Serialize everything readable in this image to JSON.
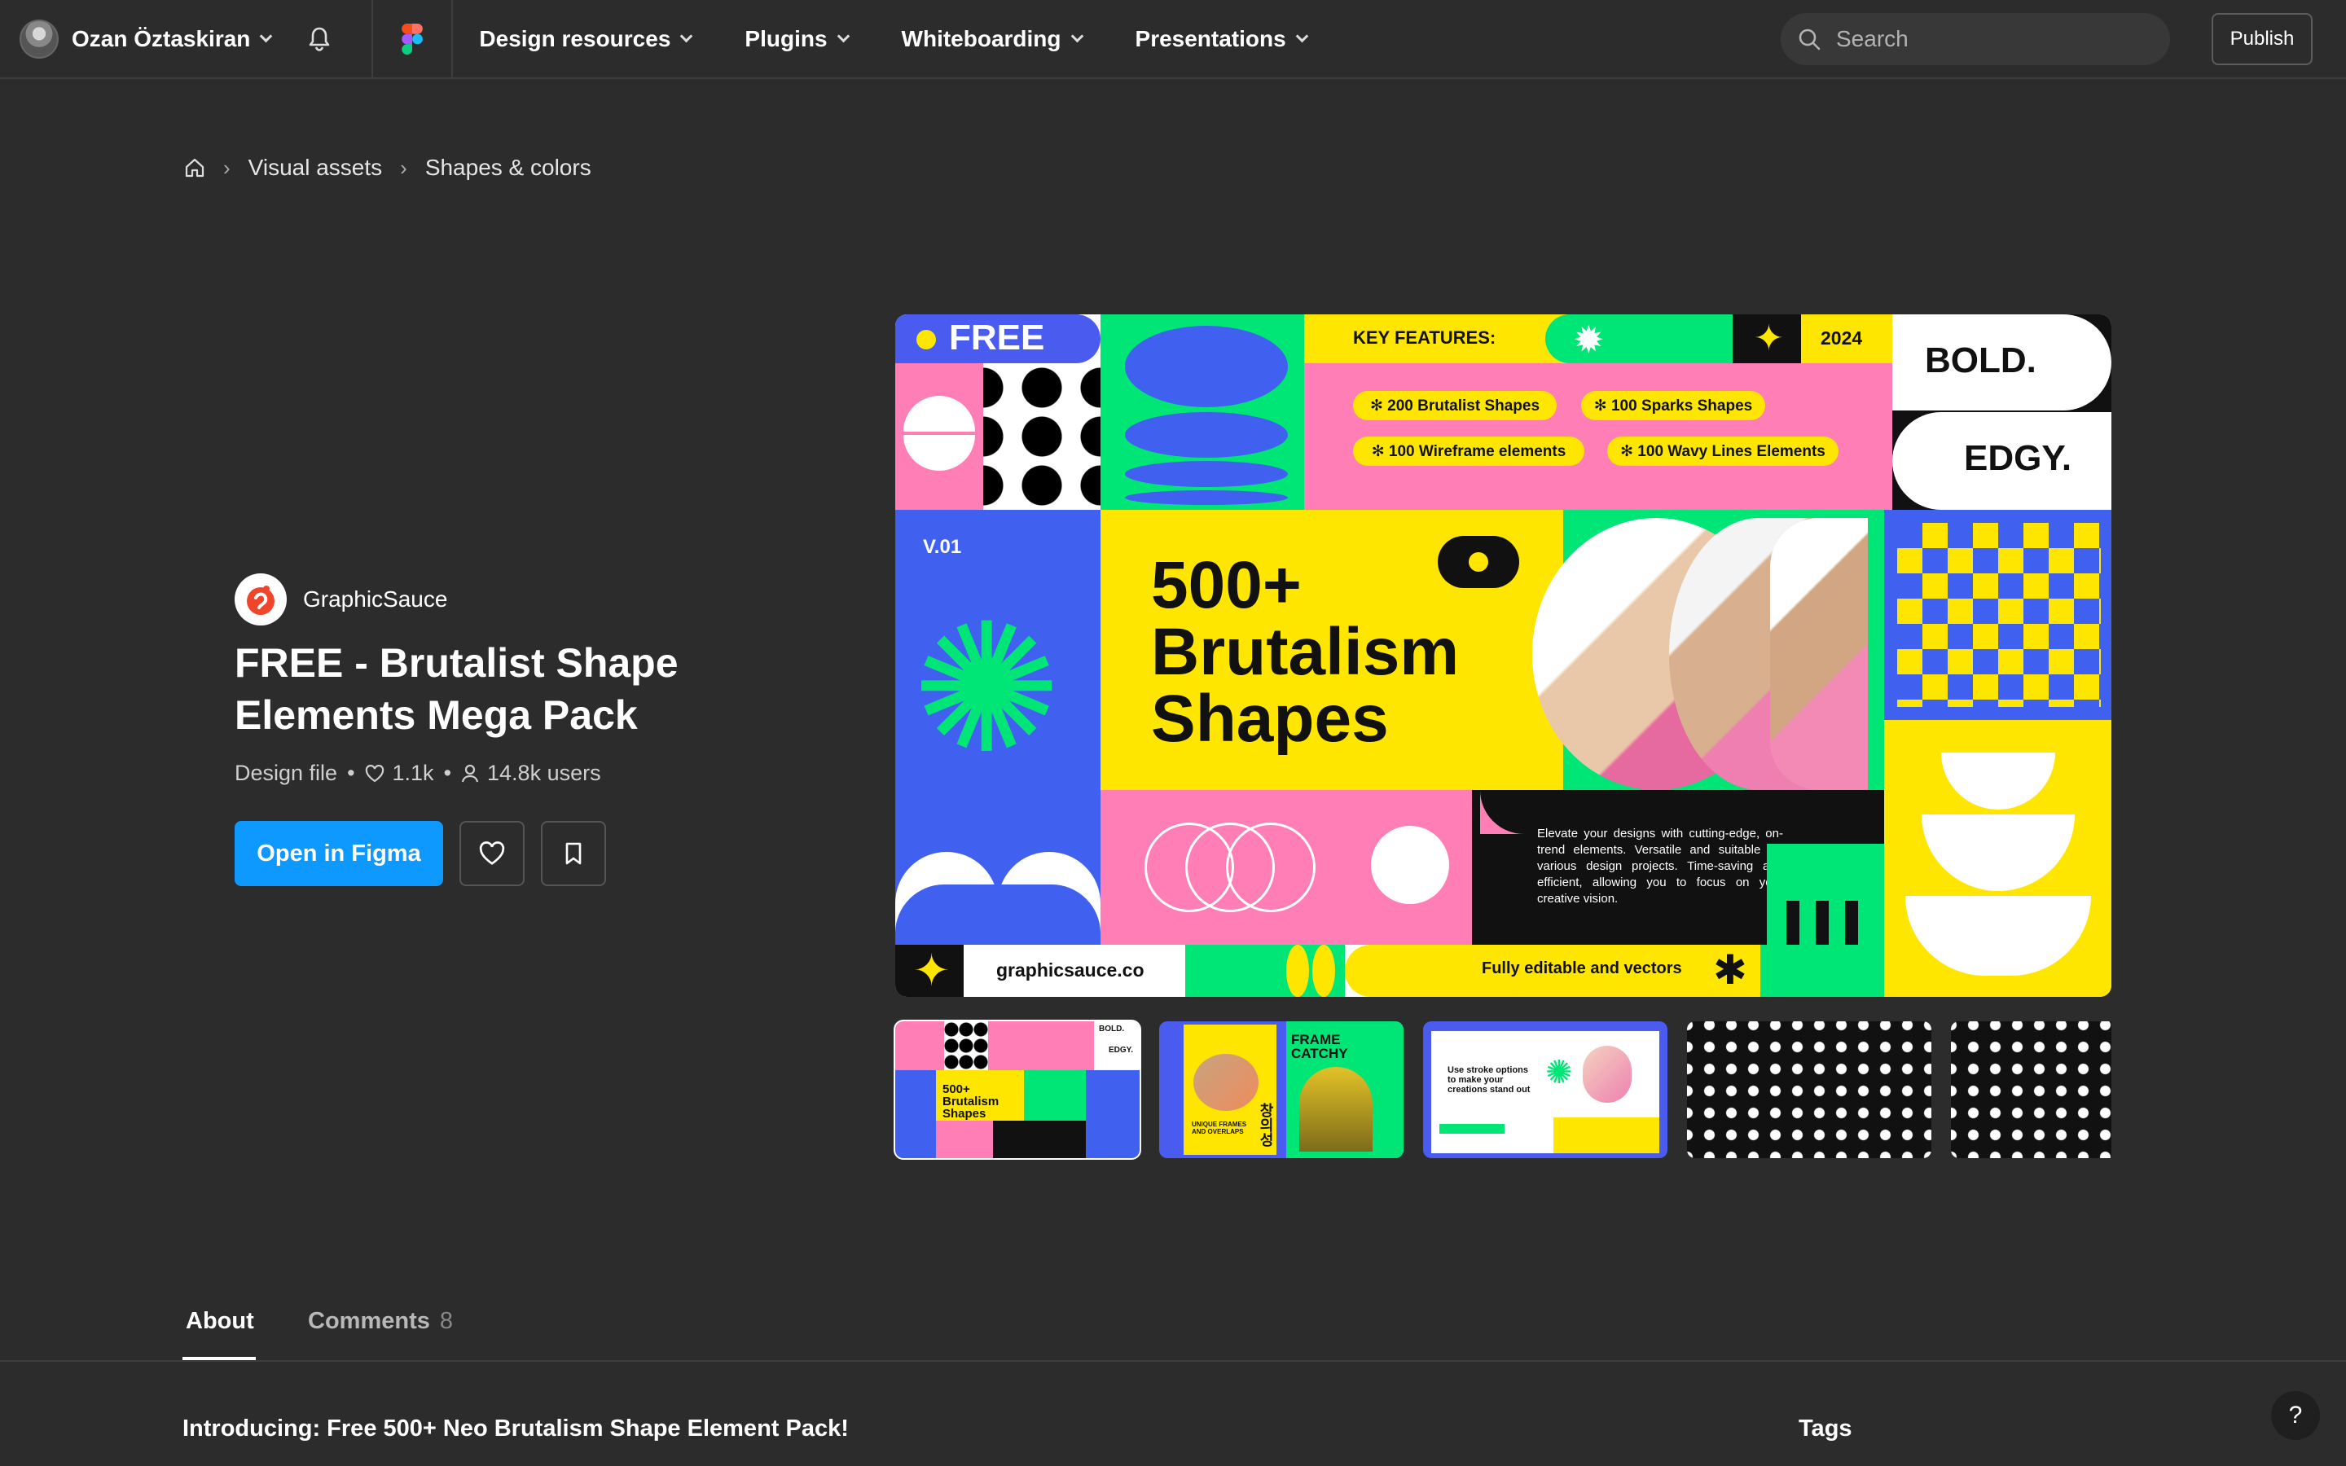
{
  "user": {
    "name": "Ozan Öztaskiran"
  },
  "nav": {
    "items": [
      {
        "label": "Design resources"
      },
      {
        "label": "Plugins"
      },
      {
        "label": "Whiteboarding"
      },
      {
        "label": "Presentations"
      }
    ]
  },
  "search": {
    "placeholder": "Search"
  },
  "publish_label": "Publish",
  "breadcrumb": {
    "item1": "Visual assets",
    "item2": "Shapes & colors"
  },
  "creator": {
    "name": "GraphicSauce"
  },
  "file": {
    "title": "FREE - Brutalist Shape Elements Mega Pack",
    "type": "Design file",
    "likes": "1.1k",
    "users": "14.8k users"
  },
  "open_label": "Open in Figma",
  "preview": {
    "free": "FREE",
    "key_features": "KEY FEATURES:",
    "year": "2024",
    "bold": "BOLD.",
    "edgy": "EDGY.",
    "feature1": "✻ 200 Brutalist Shapes",
    "feature2": "✻ 100 Sparks Shapes",
    "feature3": "✻ 100 Wireframe elements",
    "feature4": "✻ 100 Wavy Lines Elements",
    "version": "V.01",
    "headline1": "500+",
    "headline2": "Brutalism",
    "headline3": "Shapes",
    "description": "Elevate your designs with cutting-edge, on-trend elements. Versatile and suitable for various design projects. Time-saving and efficient, allowing you to focus on your creative vision.",
    "site": "graphicsauce.co",
    "editable": "Fully editable and vectors"
  },
  "thumbs": {
    "t1_bold": "BOLD.",
    "t1_edgy": "EDGY.",
    "t1_headline": "500+ Brutalism Shapes",
    "t2_title": "FRAME CATCHY",
    "t2_sub": "UNIQUE FRAMES AND OVERLAPS",
    "t2_korean": "창의성",
    "t3_text": "Use stroke options to make your creations stand out"
  },
  "tabs": {
    "about": "About",
    "comments": "Comments",
    "comments_count": "8"
  },
  "intro_heading": "Introducing: Free 500+ Neo Brutalism Shape Element Pack!",
  "tags_heading": "Tags",
  "help_label": "?",
  "colors": {
    "accent": "#0d99ff",
    "yellow": "#ffe600",
    "pink": "#ff7eb6",
    "green": "#00e676",
    "blue": "#4060f0"
  }
}
